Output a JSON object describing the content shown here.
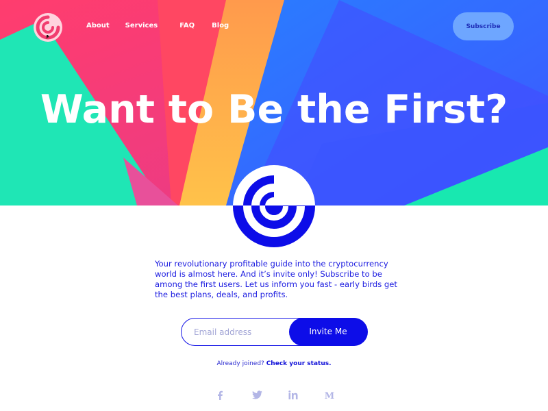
{
  "nav": {
    "links": [
      "About",
      "Services",
      "FAQ",
      "Blog"
    ],
    "subscribe_label": "Subscribe"
  },
  "hero": {
    "headline": "Want to Be the First?"
  },
  "description": "Your revolutionary profitable guide into the cryptocurrency world is almost here. And it’s invite only! Subscribe to be among the first users. Let us inform you fast - early birds get the best plans, deals, and profits.",
  "form": {
    "email_placeholder": "Email address",
    "invite_label": "Invite Me"
  },
  "status": {
    "prefix": "Already joined?",
    "link": "Check your status."
  },
  "socials": [
    "facebook-icon",
    "twitter-icon",
    "linkedin-icon",
    "medium-icon"
  ],
  "colors": {
    "brand_blue": "#0d0de8",
    "subscribe_bg": "#6ea6ff",
    "hero_pink": "#f13d6f",
    "hero_teal": "#1ee3b2",
    "hero_orange": "#ffb04a"
  }
}
